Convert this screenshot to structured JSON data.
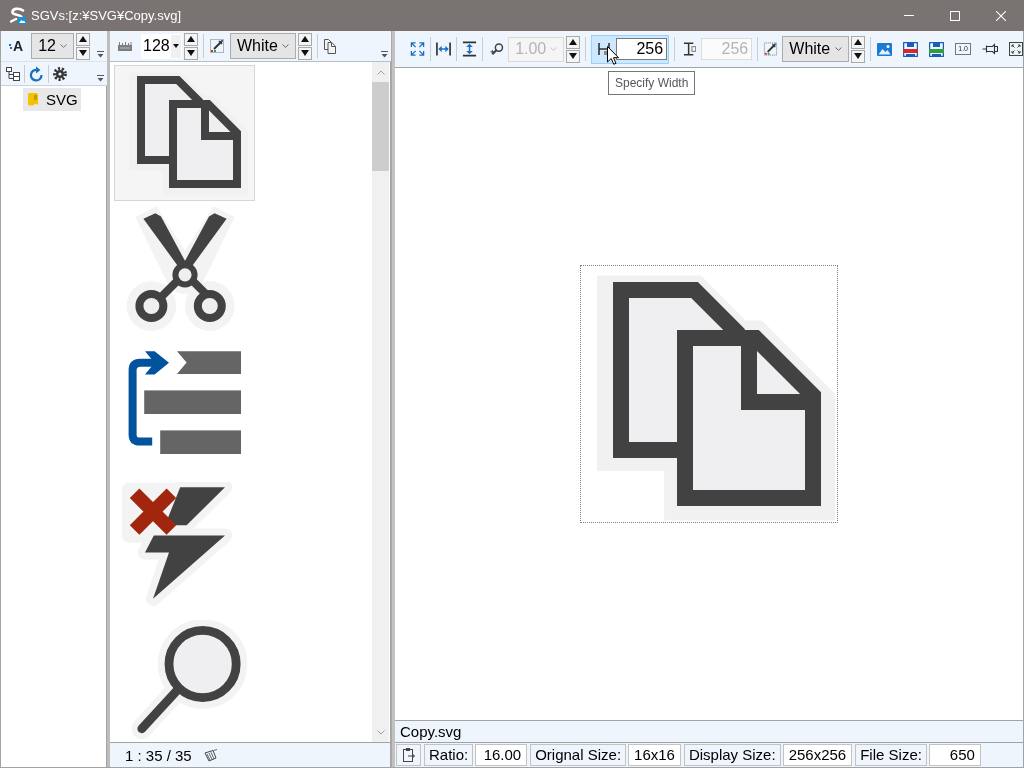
{
  "window": {
    "title": "SGVs:[z:¥SVG¥Copy.svg]"
  },
  "tree_pane": {
    "toolbar": {
      "font_glyph": "A",
      "font_size": "12"
    },
    "tree": [
      {
        "label": "SVG",
        "selected": true
      }
    ]
  },
  "list_pane": {
    "toolbar": {
      "icon_size": "128",
      "background": "White"
    },
    "items": [
      {
        "kind": "copy",
        "selected": true
      },
      {
        "kind": "scissors",
        "selected": false
      },
      {
        "kind": "indent",
        "selected": false
      },
      {
        "kind": "lightning_x",
        "selected": false
      },
      {
        "kind": "search",
        "selected": false
      }
    ],
    "status": "1 : 35 / 35"
  },
  "viewer": {
    "toolbar": {
      "zoom": {
        "value": "1.00",
        "disabled": true
      },
      "width": {
        "value": "256",
        "active": true
      },
      "height": {
        "value": "256",
        "disabled": true
      },
      "background": "White",
      "actual_size_label": "1.0"
    },
    "tooltip": "Specify Width",
    "preview": {
      "kind": "copy"
    },
    "file_name": "Copy.svg",
    "status_bar": [
      {
        "label": "Ratio:",
        "value": "16.00"
      },
      {
        "label": "Orignal Size:",
        "value": "16x16"
      },
      {
        "label": "Display Size:",
        "value": "256x256"
      },
      {
        "label": "File Size:",
        "value": "650"
      }
    ]
  }
}
